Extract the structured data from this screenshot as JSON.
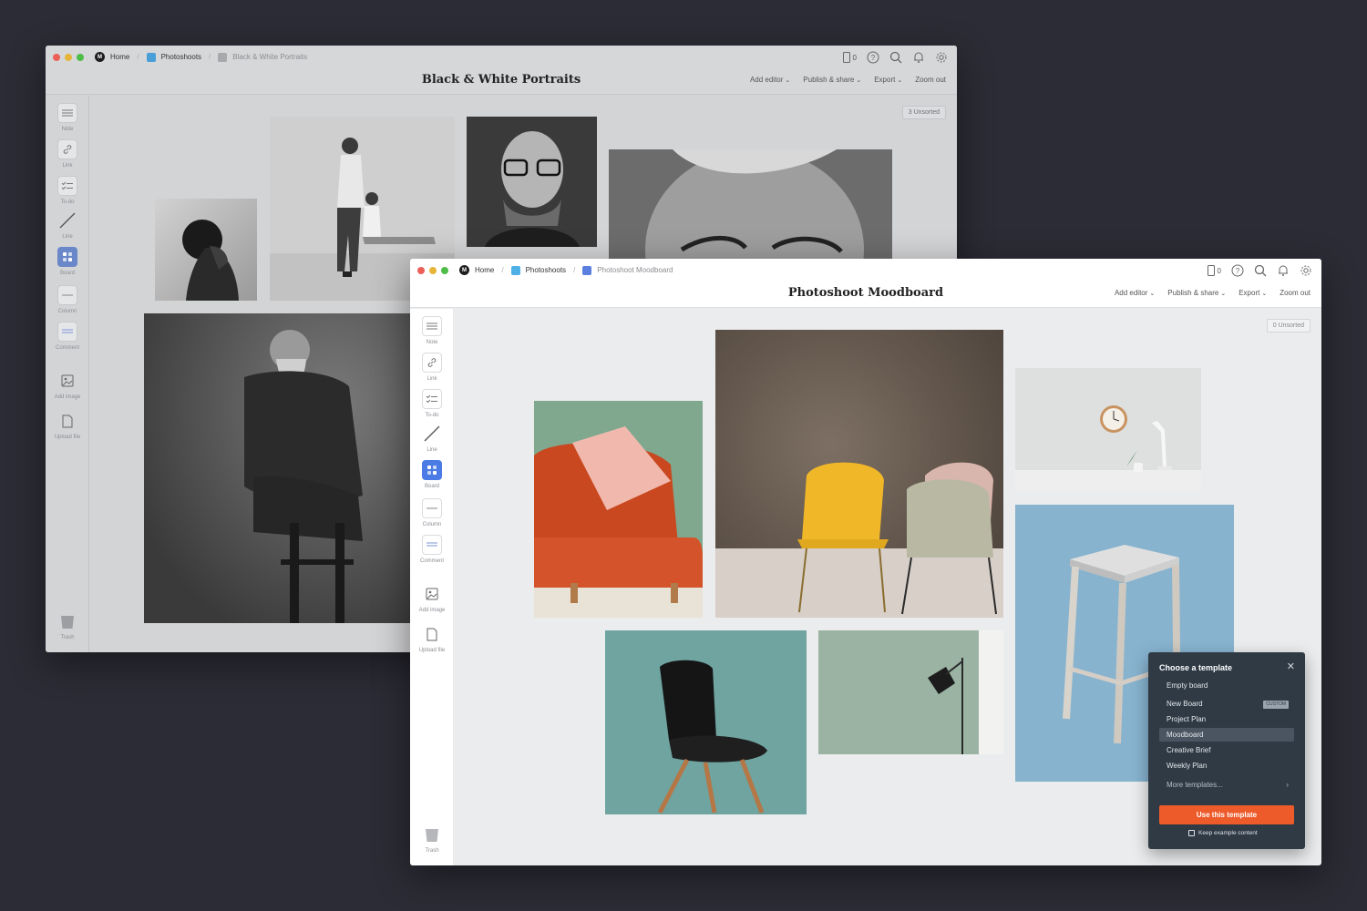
{
  "back_window": {
    "breadcrumbs": [
      "Home",
      "Photoshoots",
      "Black & White Portraits"
    ],
    "title": "Black & White Portraits",
    "device_count": "0",
    "menus": [
      "Add editor",
      "Publish & share",
      "Export",
      "Zoom out"
    ],
    "tools": [
      "Note",
      "Link",
      "To-do",
      "Line",
      "Board",
      "Column",
      "Comment",
      "Add image",
      "Upload file",
      "Trash"
    ],
    "unsorted": "3 Unsorted"
  },
  "front_window": {
    "breadcrumbs": [
      "Home",
      "Photoshoots",
      "Photoshoot Moodboard"
    ],
    "title": "Photoshoot Moodboard",
    "device_count": "0",
    "menus": [
      "Add editor",
      "Publish & share",
      "Export",
      "Zoom out"
    ],
    "tools": [
      "Note",
      "Link",
      "To-do",
      "Line",
      "Board",
      "Column",
      "Comment",
      "Add image",
      "Upload file",
      "Trash"
    ],
    "unsorted": "0 Unsorted"
  },
  "template_panel": {
    "title": "Choose a template",
    "items": [
      "Empty board",
      "New Board",
      "Project Plan",
      "Moodboard",
      "Creative Brief",
      "Weekly Plan"
    ],
    "custom_badge": "CUSTOM",
    "selected": "Moodboard",
    "more": "More templates...",
    "button": "Use this template",
    "checkbox_label": "Keep example content"
  },
  "colors": {
    "accent_blue": "#4b7ce6",
    "cta_orange": "#ee5b2b",
    "panel_dark": "#2f3a45",
    "desktop": "#2c2c36"
  }
}
